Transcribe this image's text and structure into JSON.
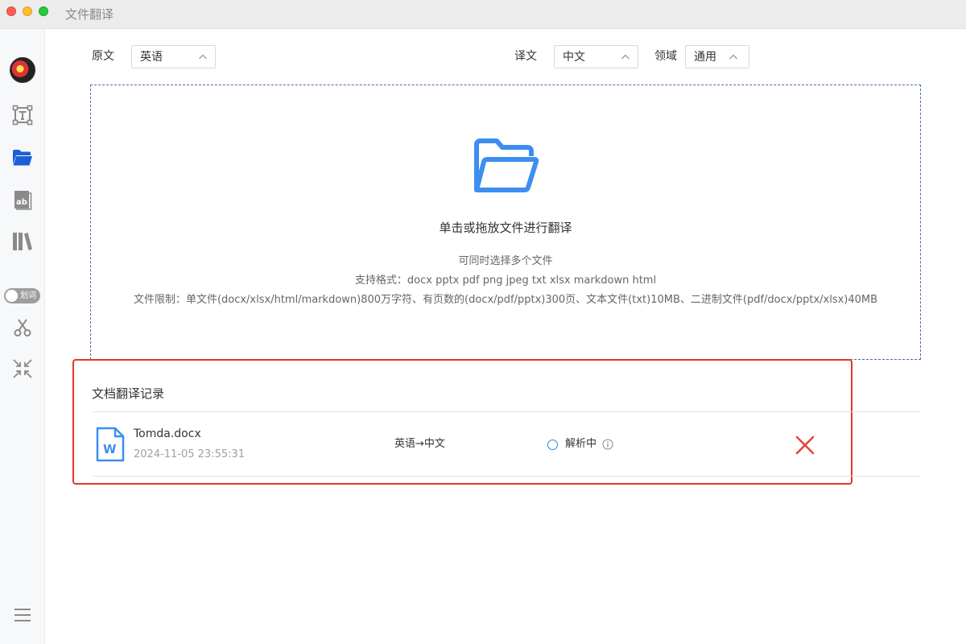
{
  "window": {
    "title": "文件翻译"
  },
  "sidebar": {
    "items": [
      {
        "name": "avatar"
      },
      {
        "name": "text-translate-icon"
      },
      {
        "name": "folder-icon",
        "active": true
      },
      {
        "name": "image-translate-icon"
      },
      {
        "name": "library-icon"
      },
      {
        "name": "scissors-icon"
      },
      {
        "name": "shrink-icon"
      },
      {
        "name": "menu-icon"
      }
    ],
    "toggle_label": "划词",
    "active_color": "#1b5fd6",
    "icon_color": "#8a8a8a"
  },
  "languages": {
    "source_label": "原文",
    "source_value": "英语",
    "target_label": "译文",
    "target_value": "中文",
    "domain_label": "领域",
    "domain_value": "通用"
  },
  "dropzone": {
    "title": "单击或拖放文件进行翻译",
    "line1": "可同时选择多个文件",
    "line2": "支持格式：docx pptx pdf png jpeg txt xlsx markdown html",
    "line3": "文件限制：单文件(docx/xlsx/html/markdown)800万字符、有页数的(docx/pdf/pptx)300页、文本文件(txt)10MB、二进制文件(pdf/docx/pptx/xlsx)40MB",
    "icon": "folder-open-icon",
    "icon_color": "#3d8ef0"
  },
  "records": {
    "title": "文档翻译记录",
    "items": [
      {
        "file_name": "Tomda.docx",
        "time": "2024-11-05 23:55:31",
        "direction": "英语→中文",
        "status": "解析中",
        "file_icon": "word-doc-icon",
        "delete_icon": "close-icon"
      }
    ]
  },
  "colors": {
    "accent": "#3d8ef0",
    "highlight_border": "#e5342b",
    "delete": "#e5453c",
    "status_ring": "#2b8bd6"
  }
}
